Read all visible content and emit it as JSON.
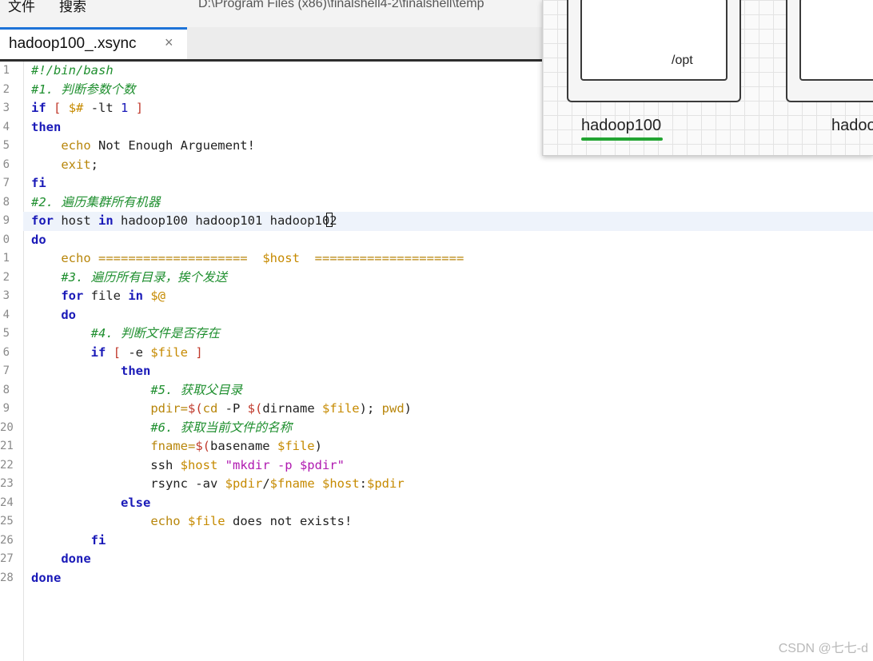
{
  "menu": {
    "items": [
      "文件",
      "搜索"
    ]
  },
  "path": "D:\\Program Files (x86)\\finalshell4-2\\finalshell\\temp",
  "tab": {
    "label": "hadoop100_.xsync",
    "close_glyph": "×"
  },
  "diagram": {
    "dir_label": "/opt",
    "host1": "hadoop100",
    "host2": "hadoo"
  },
  "watermark": "CSDN @七七-d",
  "current_line": 9,
  "editor": {
    "lines": [
      {
        "n": "1",
        "text": "#!/bin/bash"
      },
      {
        "n": "2",
        "text": "#1. 判断参数个数"
      },
      {
        "n": "3",
        "text": "if [ $# -lt 1 ]"
      },
      {
        "n": "4",
        "text": "then"
      },
      {
        "n": "5",
        "text": "    echo Not Enough Arguement!"
      },
      {
        "n": "6",
        "text": "    exit;"
      },
      {
        "n": "7",
        "text": "fi"
      },
      {
        "n": "8",
        "text": "#2. 遍历集群所有机器"
      },
      {
        "n": "9",
        "text": "for host in hadoop100 hadoop101 hadoop102"
      },
      {
        "n": "0",
        "text": "do"
      },
      {
        "n": "1",
        "text": "    echo ====================  $host  ===================="
      },
      {
        "n": "2",
        "text": "    #3. 遍历所有目录，挨个发送"
      },
      {
        "n": "3",
        "text": "    for file in $@"
      },
      {
        "n": "4",
        "text": "    do"
      },
      {
        "n": "5",
        "text": "        #4. 判断文件是否存在"
      },
      {
        "n": "6",
        "text": "        if [ -e $file ]"
      },
      {
        "n": "7",
        "text": "            then"
      },
      {
        "n": "8",
        "text": "                #5. 获取父目录"
      },
      {
        "n": "9",
        "text": "                pdir=$(cd -P $(dirname $file); pwd)"
      },
      {
        "n": "20",
        "text": "                #6. 获取当前文件的名称"
      },
      {
        "n": "21",
        "text": "                fname=$(basename $file)"
      },
      {
        "n": "22",
        "text": "                ssh $host \"mkdir -p $pdir\""
      },
      {
        "n": "23",
        "text": "                rsync -av $pdir/$fname $host:$pdir"
      },
      {
        "n": "24",
        "text": "            else"
      },
      {
        "n": "25",
        "text": "                echo $file does not exists!"
      },
      {
        "n": "26",
        "text": "        fi"
      },
      {
        "n": "27",
        "text": "    done"
      },
      {
        "n": "28",
        "text": "done"
      }
    ]
  }
}
